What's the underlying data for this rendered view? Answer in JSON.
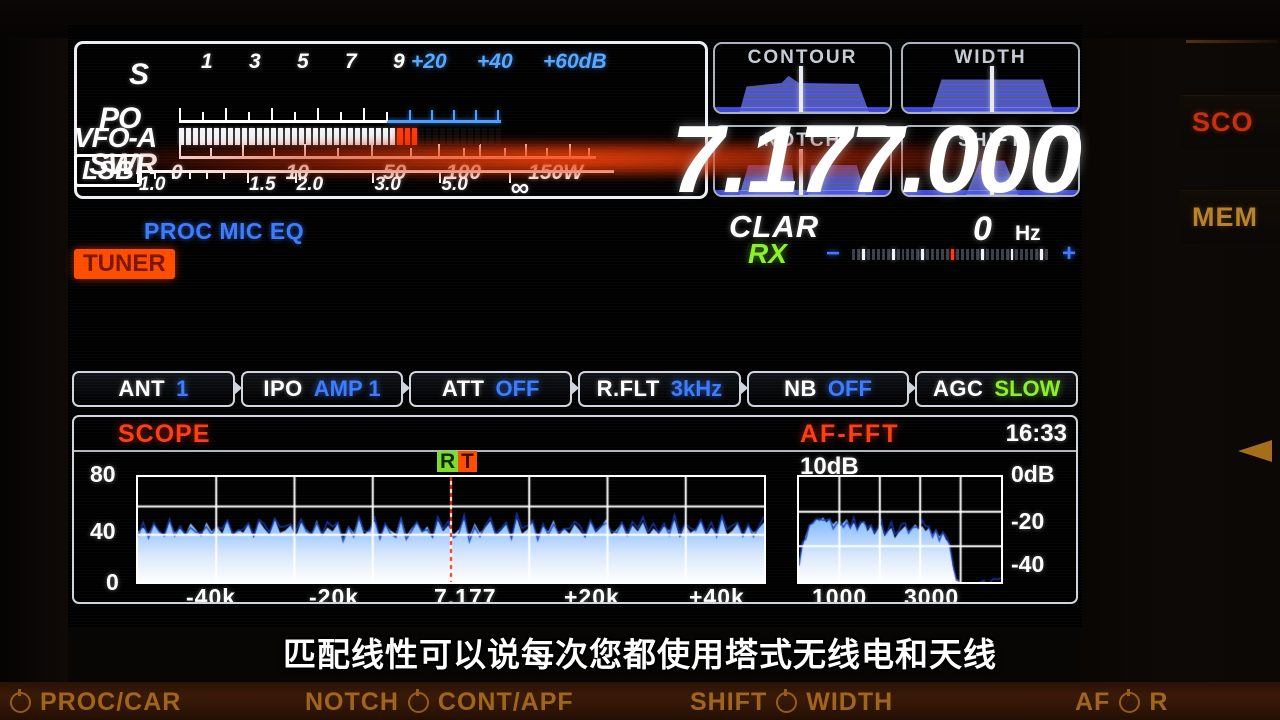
{
  "meter": {
    "rows": [
      {
        "name": "S",
        "label": "S"
      },
      {
        "name": "PO",
        "label": "PO"
      },
      {
        "name": "SWR",
        "label": "SWR"
      }
    ],
    "s_scale": [
      "1",
      "3",
      "5",
      "7",
      "9"
    ],
    "s_scale_db": [
      "+20",
      "+40",
      "+60dB"
    ],
    "po_scale": [
      "0",
      "10",
      "50",
      "100",
      "150W"
    ],
    "swr_scale": [
      "1.0",
      "1.5",
      "2.0",
      "3.0",
      "5.0",
      "∞"
    ],
    "s_reading_percent": 74,
    "s_peak_segments": 3
  },
  "dsp_panels": [
    {
      "title": "CONTOUR",
      "shape": "contour"
    },
    {
      "title": "WIDTH",
      "shape": "width"
    },
    {
      "title": "NOTCH",
      "shape": "notch"
    },
    {
      "title": "SHIFT",
      "shape": "shift"
    }
  ],
  "vfo": {
    "name": "VFO-A",
    "mode": "LSB",
    "frequency": "7.177.000",
    "proc_flags": "PROC  MIC EQ",
    "tuner": "TUNER"
  },
  "clarifier": {
    "title": "CLAR",
    "state": "RX",
    "value": "0",
    "unit": "Hz",
    "minus": "−",
    "plus": "+"
  },
  "function_buttons": [
    {
      "key": "ANT",
      "value": "1",
      "value_color": "blue"
    },
    {
      "key": "IPO",
      "value": "AMP 1",
      "value_color": "blue"
    },
    {
      "key": "ATT",
      "value": "OFF",
      "value_color": "blue"
    },
    {
      "key": "R.FLT",
      "value": "3kHz",
      "value_color": "blue"
    },
    {
      "key": "NB",
      "value": "OFF",
      "value_color": "blue"
    },
    {
      "key": "AGC",
      "value": "SLOW",
      "value_color": "green"
    }
  ],
  "scope": {
    "title": "SCOPE",
    "af_title": "AF-FFT",
    "clock": "16:33",
    "af_step": "10dB",
    "rt_badge": {
      "left": "R",
      "right": "T"
    }
  },
  "chart_data": [
    {
      "type": "area",
      "name": "band-scope",
      "title": "SCOPE",
      "xlabel": "",
      "ylabel": "",
      "x_ticks": [
        "-40k",
        "-20k",
        "7.177",
        "+20k",
        "+40k"
      ],
      "y_ticks": [
        "80",
        "40",
        "0"
      ],
      "ylim": [
        0,
        100
      ],
      "grid": true,
      "center_marker": "7.177",
      "noise_floor": 44,
      "values": [
        48,
        52,
        46,
        55,
        49,
        44,
        58,
        47,
        51,
        45,
        56,
        50,
        43,
        57,
        48,
        53,
        46,
        59,
        44,
        50,
        47,
        55,
        42,
        58,
        51,
        45,
        60,
        47,
        49,
        54,
        43,
        57,
        50,
        46,
        59,
        44,
        52,
        48,
        56,
        41,
        53,
        47,
        61,
        45,
        50,
        58,
        43,
        55,
        49,
        46,
        62,
        44,
        51,
        57,
        47,
        53,
        42,
        59,
        48,
        54,
        45,
        50,
        60,
        43,
        56,
        47,
        52,
        58,
        44,
        49,
        55,
        41,
        61,
        46,
        50,
        57,
        43,
        53,
        48,
        59,
        44,
        51,
        46,
        55,
        49,
        42,
        58,
        47,
        52,
        60,
        45,
        50,
        56,
        43,
        54,
        48,
        57,
        44,
        51,
        46,
        53,
        49,
        59,
        42,
        55,
        47,
        50,
        58,
        44,
        52,
        46,
        61,
        45,
        49,
        56,
        43,
        54,
        47,
        51,
        57
      ]
    },
    {
      "type": "area",
      "name": "af-fft",
      "title": "AF-FFT",
      "xlabel": "",
      "ylabel": "dB",
      "x_ticks": [
        "1000",
        "3000"
      ],
      "y_ticks": [
        "0dB",
        "-20",
        "-40"
      ],
      "ylim": [
        -60,
        0
      ],
      "grid": true,
      "values": [
        -48,
        -40,
        -33,
        -28,
        -26,
        -24,
        -25,
        -23,
        -26,
        -24,
        -27,
        -25,
        -28,
        -26,
        -24,
        -29,
        -26,
        -30,
        -27,
        -25,
        -31,
        -28,
        -33,
        -30,
        -27,
        -34,
        -31,
        -29,
        -35,
        -32,
        -30,
        -28,
        -31,
        -29,
        -27,
        -30,
        -28,
        -31,
        -29,
        -33,
        -30,
        -34,
        -32,
        -36,
        -38,
        -52,
        -58,
        -60,
        -60,
        -60,
        -60,
        -60,
        -60,
        -60,
        -60,
        -60,
        -60,
        -60,
        -60,
        -60
      ]
    }
  ],
  "subtitle": "匹配线性可以说每次您都使用塔式无线电和天线",
  "side_buttons": [
    {
      "label": "SCO",
      "color": "#c8300c"
    },
    {
      "label": "MEM",
      "color": "#b9832c"
    }
  ],
  "bottom_panel": [
    {
      "label_left": "PROC/CAR",
      "label_right": "",
      "knob": true
    },
    {
      "label_left": "NOTCH",
      "label_right": "CONT/APF",
      "knob": true
    },
    {
      "label_left": "SHIFT",
      "label_right": "WIDTH",
      "knob": true
    },
    {
      "label_left": "AF",
      "label_right": "R",
      "knob": true
    }
  ]
}
